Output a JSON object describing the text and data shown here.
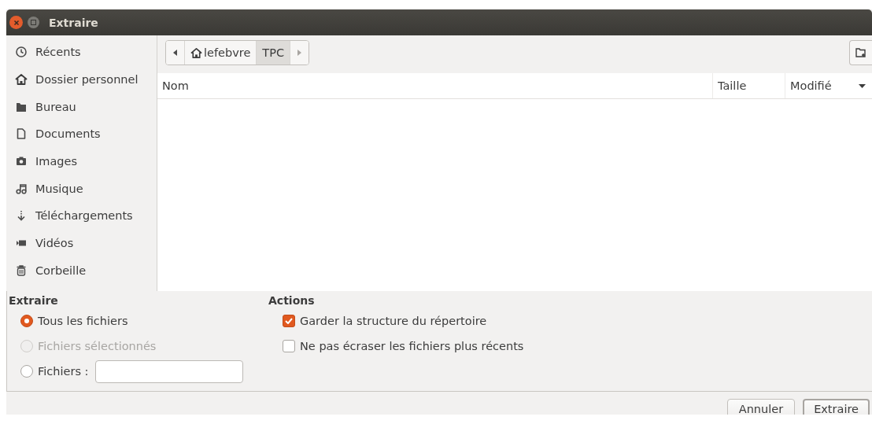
{
  "window": {
    "title": "Extraire"
  },
  "sidebar": {
    "items": [
      {
        "label": "Récents",
        "kind": "clock"
      },
      {
        "label": "Dossier personnel",
        "kind": "home"
      },
      {
        "label": "Bureau",
        "kind": "folder"
      },
      {
        "label": "Documents",
        "kind": "document"
      },
      {
        "label": "Images",
        "kind": "camera"
      },
      {
        "label": "Musique",
        "kind": "music"
      },
      {
        "label": "Téléchargements",
        "kind": "download"
      },
      {
        "label": "Vidéos",
        "kind": "video"
      },
      {
        "label": "Corbeille",
        "kind": "trash"
      }
    ]
  },
  "path_bar": {
    "segments": [
      {
        "label": "lefebvre",
        "kind": "home",
        "selected": false
      },
      {
        "label": "TPC",
        "kind": "plain",
        "selected": true
      }
    ]
  },
  "table": {
    "columns": [
      {
        "label": "Nom",
        "sorted": false
      },
      {
        "label": "Taille",
        "sorted": false
      },
      {
        "label": "Modifié",
        "sorted": true
      }
    ]
  },
  "extract": {
    "title": "Extraire",
    "options": [
      {
        "label": "Tous les fichiers",
        "selected": true,
        "disabled": false,
        "kind": "plain"
      },
      {
        "label": "Fichiers sélectionnés",
        "selected": false,
        "disabled": true,
        "kind": "plain"
      },
      {
        "label": "Fichiers :",
        "selected": false,
        "disabled": false,
        "kind": "field"
      }
    ]
  },
  "actions": {
    "title": "Actions",
    "options": [
      {
        "label": "Garder la structure du répertoire",
        "checked": true
      },
      {
        "label": "Ne pas écraser les fichiers plus récents",
        "checked": false
      }
    ]
  },
  "buttons": [
    {
      "label": "Annuler",
      "kind": "normal"
    },
    {
      "label": "Extraire",
      "kind": "default"
    }
  ]
}
